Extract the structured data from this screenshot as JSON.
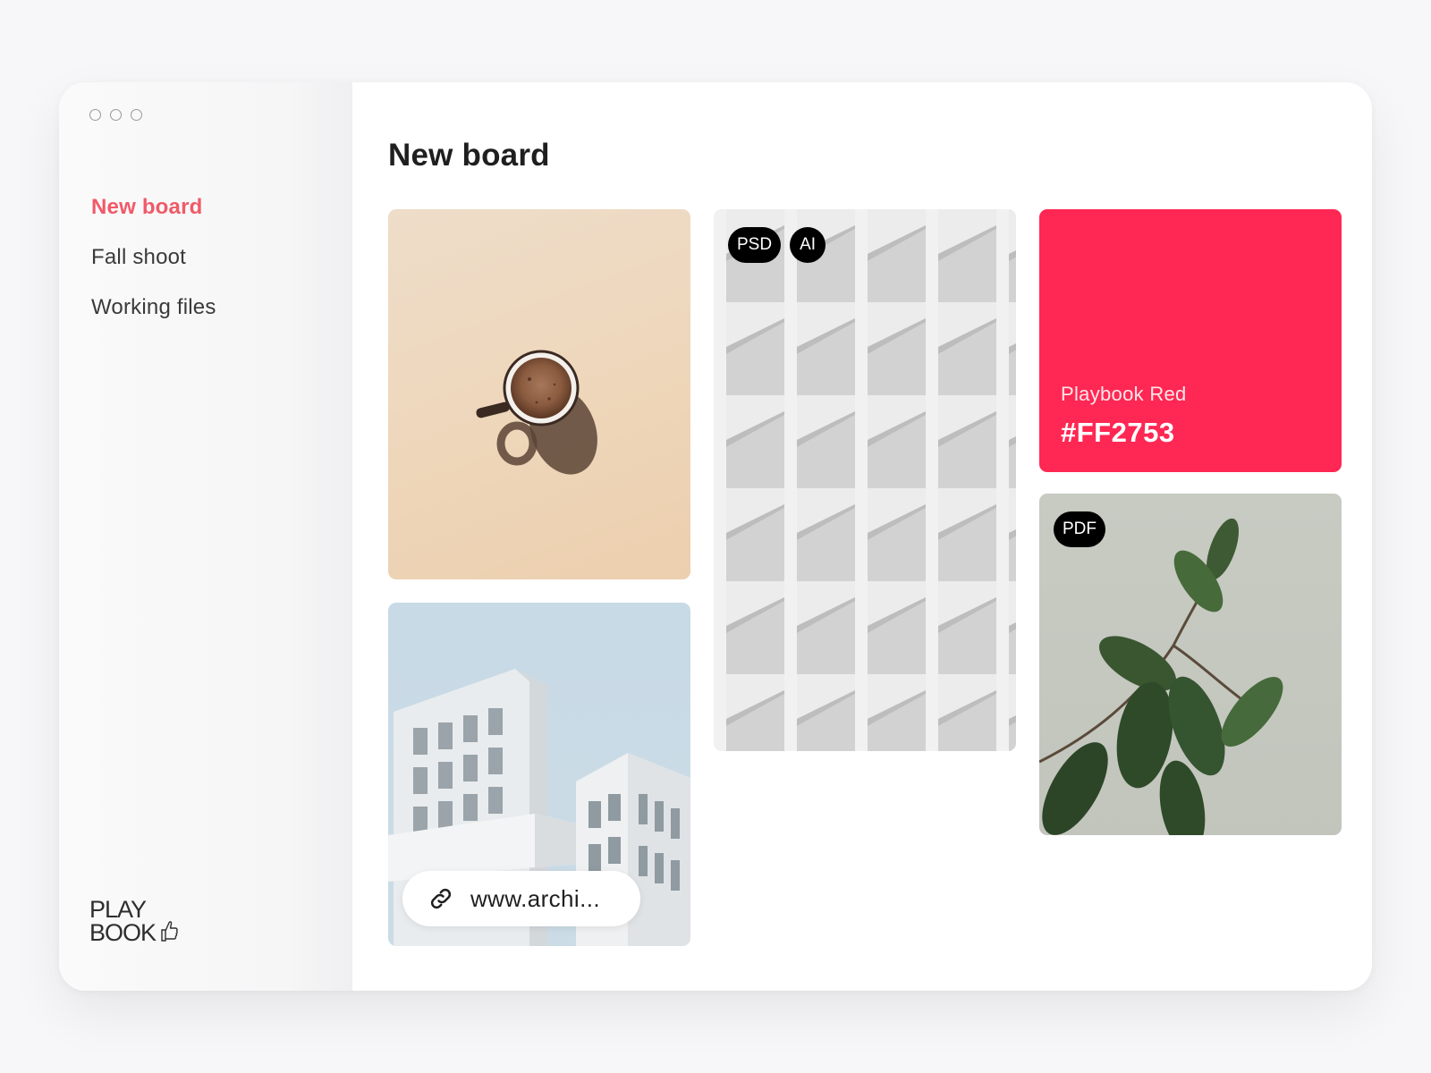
{
  "window": {
    "controls": [
      "close",
      "minimize",
      "zoom"
    ]
  },
  "sidebar": {
    "items": [
      {
        "label": "New board",
        "active": true
      },
      {
        "label": "Fall shoot",
        "active": false
      },
      {
        "label": "Working files",
        "active": false
      }
    ],
    "logo": {
      "line1": "PLAY",
      "line2": "BOOK",
      "icon": "thumbs-up-icon"
    }
  },
  "main": {
    "title": "New board",
    "cards": {
      "coffee": {
        "icon": "coffee-cup-photo"
      },
      "facade": {
        "badges": [
          "PSD",
          "AI"
        ]
      },
      "color": {
        "name": "Playbook Red",
        "hex": "#FF2753",
        "swatch": "#ff2753"
      },
      "building": {
        "link_text": "www.archi...",
        "icon": "link-icon"
      },
      "plant": {
        "badges": [
          "PDF"
        ]
      }
    }
  },
  "colors": {
    "accent": "#f05a68",
    "badge": "#000000"
  }
}
